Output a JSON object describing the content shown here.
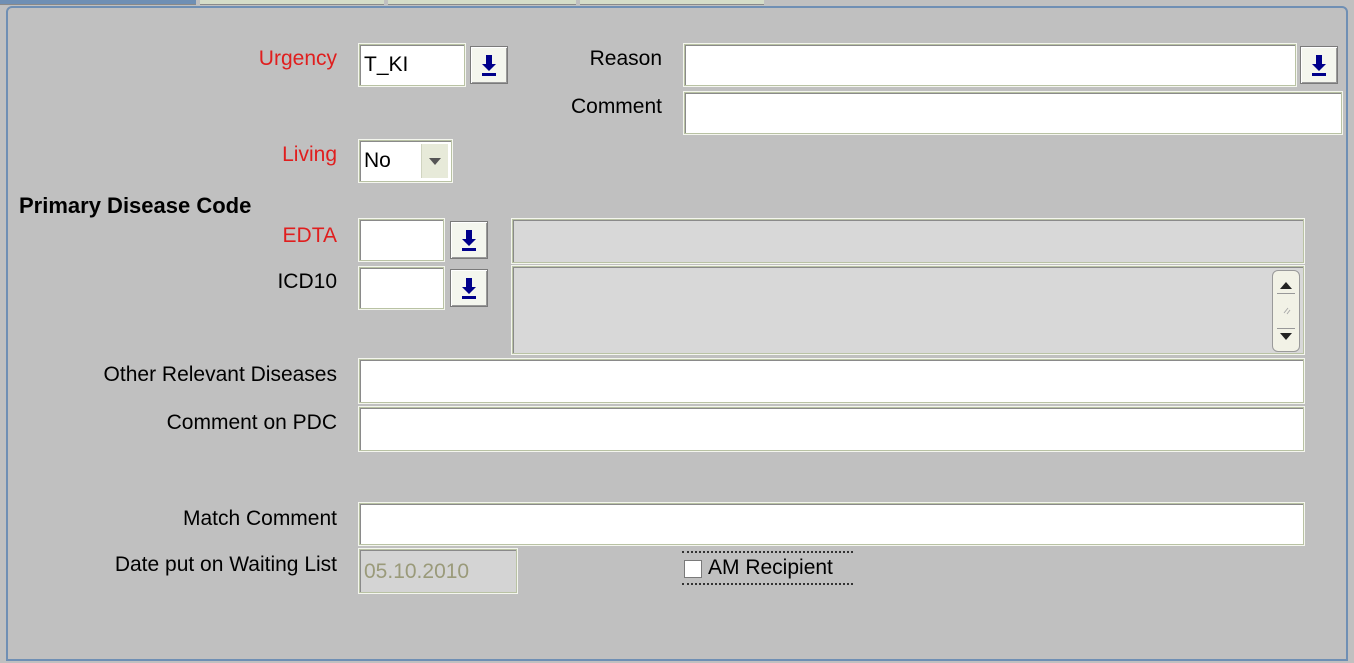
{
  "form": {
    "urgency": {
      "label": "Urgency",
      "value": "T_KI"
    },
    "reason": {
      "label": "Reason",
      "value": ""
    },
    "comment": {
      "label": "Comment",
      "value": ""
    },
    "living": {
      "label": "Living",
      "selected": "No"
    },
    "primary_disease_code": {
      "heading": "Primary Disease Code"
    },
    "edta": {
      "label": "EDTA",
      "value": "",
      "description": ""
    },
    "icd10": {
      "label": "ICD10",
      "value": "",
      "description": ""
    },
    "other_relevant_diseases": {
      "label": "Other Relevant Diseases",
      "value": ""
    },
    "comment_on_pdc": {
      "label": "Comment on PDC",
      "value": ""
    },
    "match_comment": {
      "label": "Match Comment",
      "value": ""
    },
    "date_put_on_waiting_list": {
      "label": "Date put on Waiting List",
      "value": "05.10.2010"
    },
    "am_recipient": {
      "label": "AM Recipient",
      "checked": false
    }
  },
  "icons": {
    "lov_button": "download-arrow-icon",
    "combo": "chevron-down-icon",
    "scroll_up": "arrow-up-icon",
    "scroll_down": "arrow-down-icon"
  },
  "colors": {
    "required_label": "#e01e1e",
    "panel_bg": "#c0c0c0",
    "lov_arrow": "#00008b"
  }
}
